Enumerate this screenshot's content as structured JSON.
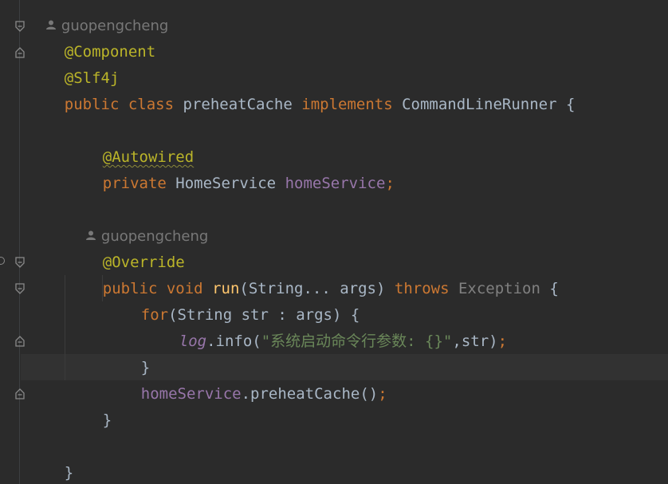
{
  "author_hints": [
    {
      "text": "guopengcheng"
    },
    {
      "text": "guopengcheng"
    }
  ],
  "code": {
    "annotation_component": "@Component",
    "annotation_slf4j": "@Slf4j",
    "class_decl": {
      "kw_public": "public",
      "kw_class": "class",
      "class_name": "preheatCache",
      "kw_implements": "implements",
      "interface_name": "CommandLineRunner",
      "brace_open": "{"
    },
    "annotation_autowired": "@Autowired",
    "field_decl": {
      "kw_private": "private",
      "type": "HomeService",
      "name": "homeService",
      "semicolon": ";"
    },
    "annotation_override": "@Override",
    "method_decl": {
      "kw_public": "public",
      "kw_void": "void",
      "name": "run",
      "params": "(String... args)",
      "kw_throws": "throws",
      "exception": "Exception",
      "brace_open": "{"
    },
    "for_stmt": {
      "kw_for": "for",
      "rest": "(String str : args) {"
    },
    "log_stmt": {
      "log": "log",
      "call": ".info(",
      "string": "\"系统启动命令行参数: {}\"",
      "args": ",str)",
      "semicolon": ";"
    },
    "for_close": "}",
    "preheat_stmt": {
      "field": "homeService",
      "call": ".preheatCache()",
      "semicolon": ";"
    },
    "method_close": "}",
    "class_close": "}"
  },
  "icons": {
    "fold": "fold-marker-icon",
    "person": "person-icon",
    "run": "run-gutter-icon"
  },
  "colors": {
    "background": "#2b2b2b",
    "current_line": "#323232",
    "annotation": "#bbb529",
    "keyword": "#cc7832",
    "method": "#ffc66d",
    "field": "#9876aa",
    "string": "#6a8759",
    "text": "#a9b7c6"
  }
}
